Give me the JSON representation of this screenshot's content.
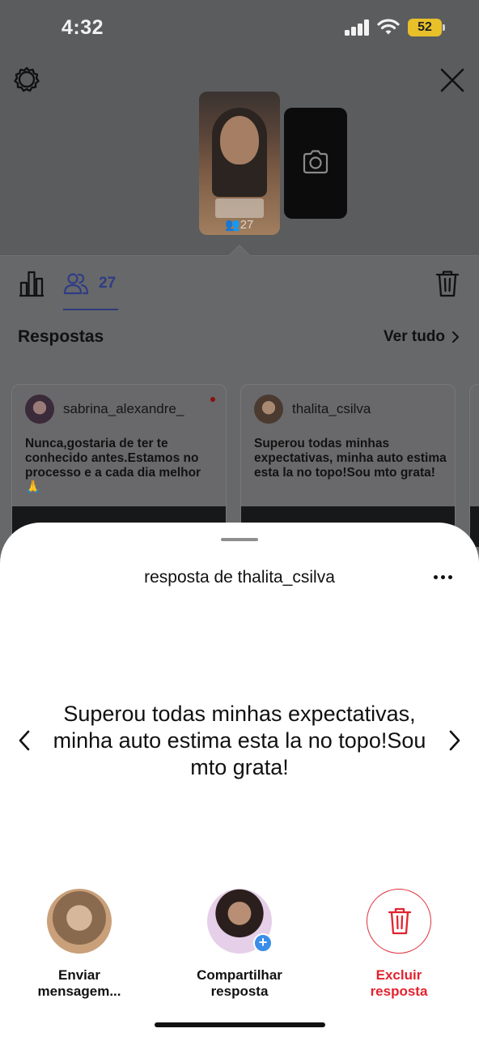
{
  "status_bar": {
    "time": "4:32",
    "battery": "52"
  },
  "story_preview": {
    "viewer_count": "27"
  },
  "tabs": {
    "viewers_count": "27"
  },
  "responses": {
    "title": "Respostas",
    "see_all": "Ver tudo",
    "cards": [
      {
        "username": "sabrina_alexandre_",
        "text": "Nunca,gostaria de ter te conhecido antes.Estamos no processo e a cada dia melhor 🙏",
        "unread": true
      },
      {
        "username": "thalita_csilva",
        "text": "Superou todas minhas expectativas, minha auto estima esta la no topo!Sou mto grata!",
        "unread": false
      }
    ]
  },
  "sheet": {
    "title": "resposta de thalita_csilva",
    "answer": "Superou todas minhas expectativas, minha auto estima esta la no topo!Sou mto grata!",
    "actions": [
      {
        "label_line1": "Enviar",
        "label_line2": "mensagem..."
      },
      {
        "label_line1": "Compartilhar",
        "label_line2": "resposta"
      },
      {
        "label_line1": "Excluir",
        "label_line2": "resposta"
      }
    ]
  },
  "colors": {
    "accent_blue": "#2f3c86",
    "delete_red": "#e2232f",
    "badge_blue": "#3a8ee8",
    "battery_yellow": "#e8c02a"
  },
  "icons": [
    "settings-icon",
    "close-icon",
    "camera-icon",
    "insights-icon",
    "viewers-icon",
    "trash-icon",
    "chevron-right-icon",
    "more-icon",
    "chevron-left-icon",
    "plus-icon"
  ]
}
